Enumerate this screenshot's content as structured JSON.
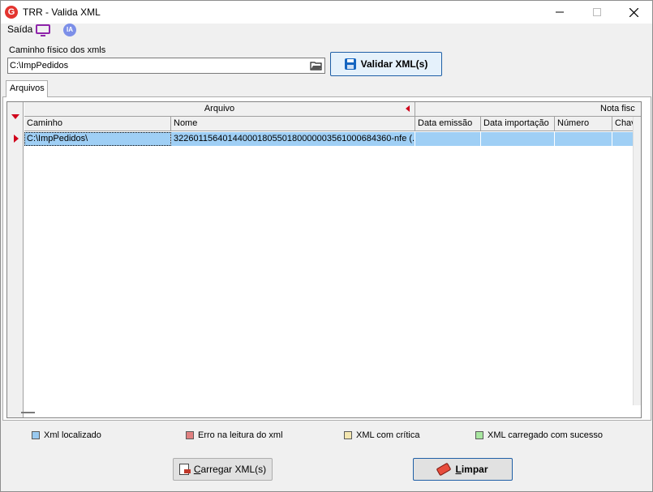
{
  "window": {
    "title": "TRR - Valida XML",
    "logo_letter": "G"
  },
  "menu": {
    "saida_label": "Saída",
    "ia_label": "IA"
  },
  "path": {
    "label": "Caminho físico dos xmls",
    "value": "C:\\ImpPedidos"
  },
  "toolbar": {
    "validar_label": "Validar XML(s)"
  },
  "tabs": {
    "arquivos_label": "Arquivos"
  },
  "grid": {
    "bands": {
      "arquivo": "Arquivo",
      "nota_fiscal": "Nota fisc"
    },
    "columns": {
      "caminho": "Caminho",
      "nome": "Nome",
      "data_emissao": "Data emissão",
      "data_importacao": "Data importação",
      "numero": "Número",
      "chave": "Chav"
    },
    "rows": [
      {
        "caminho": "C:\\ImpPedidos\\",
        "nome": "32260115640144000180550180000003561000684360-nfe (...",
        "data_emissao": "",
        "data_importacao": "",
        "numero": "",
        "chave": ""
      }
    ]
  },
  "legend": {
    "localizado": {
      "label": "Xml localizado",
      "color": "#99c9f0"
    },
    "erro": {
      "label": "Erro na leitura do xml",
      "color": "#e08080"
    },
    "critica": {
      "label": "XML com crítica",
      "color": "#f3e6b0"
    },
    "sucesso": {
      "label": "XML carregado com sucesso",
      "color": "#a8e6a0"
    }
  },
  "buttons": {
    "carregar_prefix": "C",
    "carregar_rest": "arregar XML(s)",
    "limpar_prefix": "L",
    "limpar_rest": "impar"
  },
  "colors": {
    "selection": "#9fcff5",
    "accent_red": "#d0021b",
    "primary_border": "#1f5fa6"
  }
}
